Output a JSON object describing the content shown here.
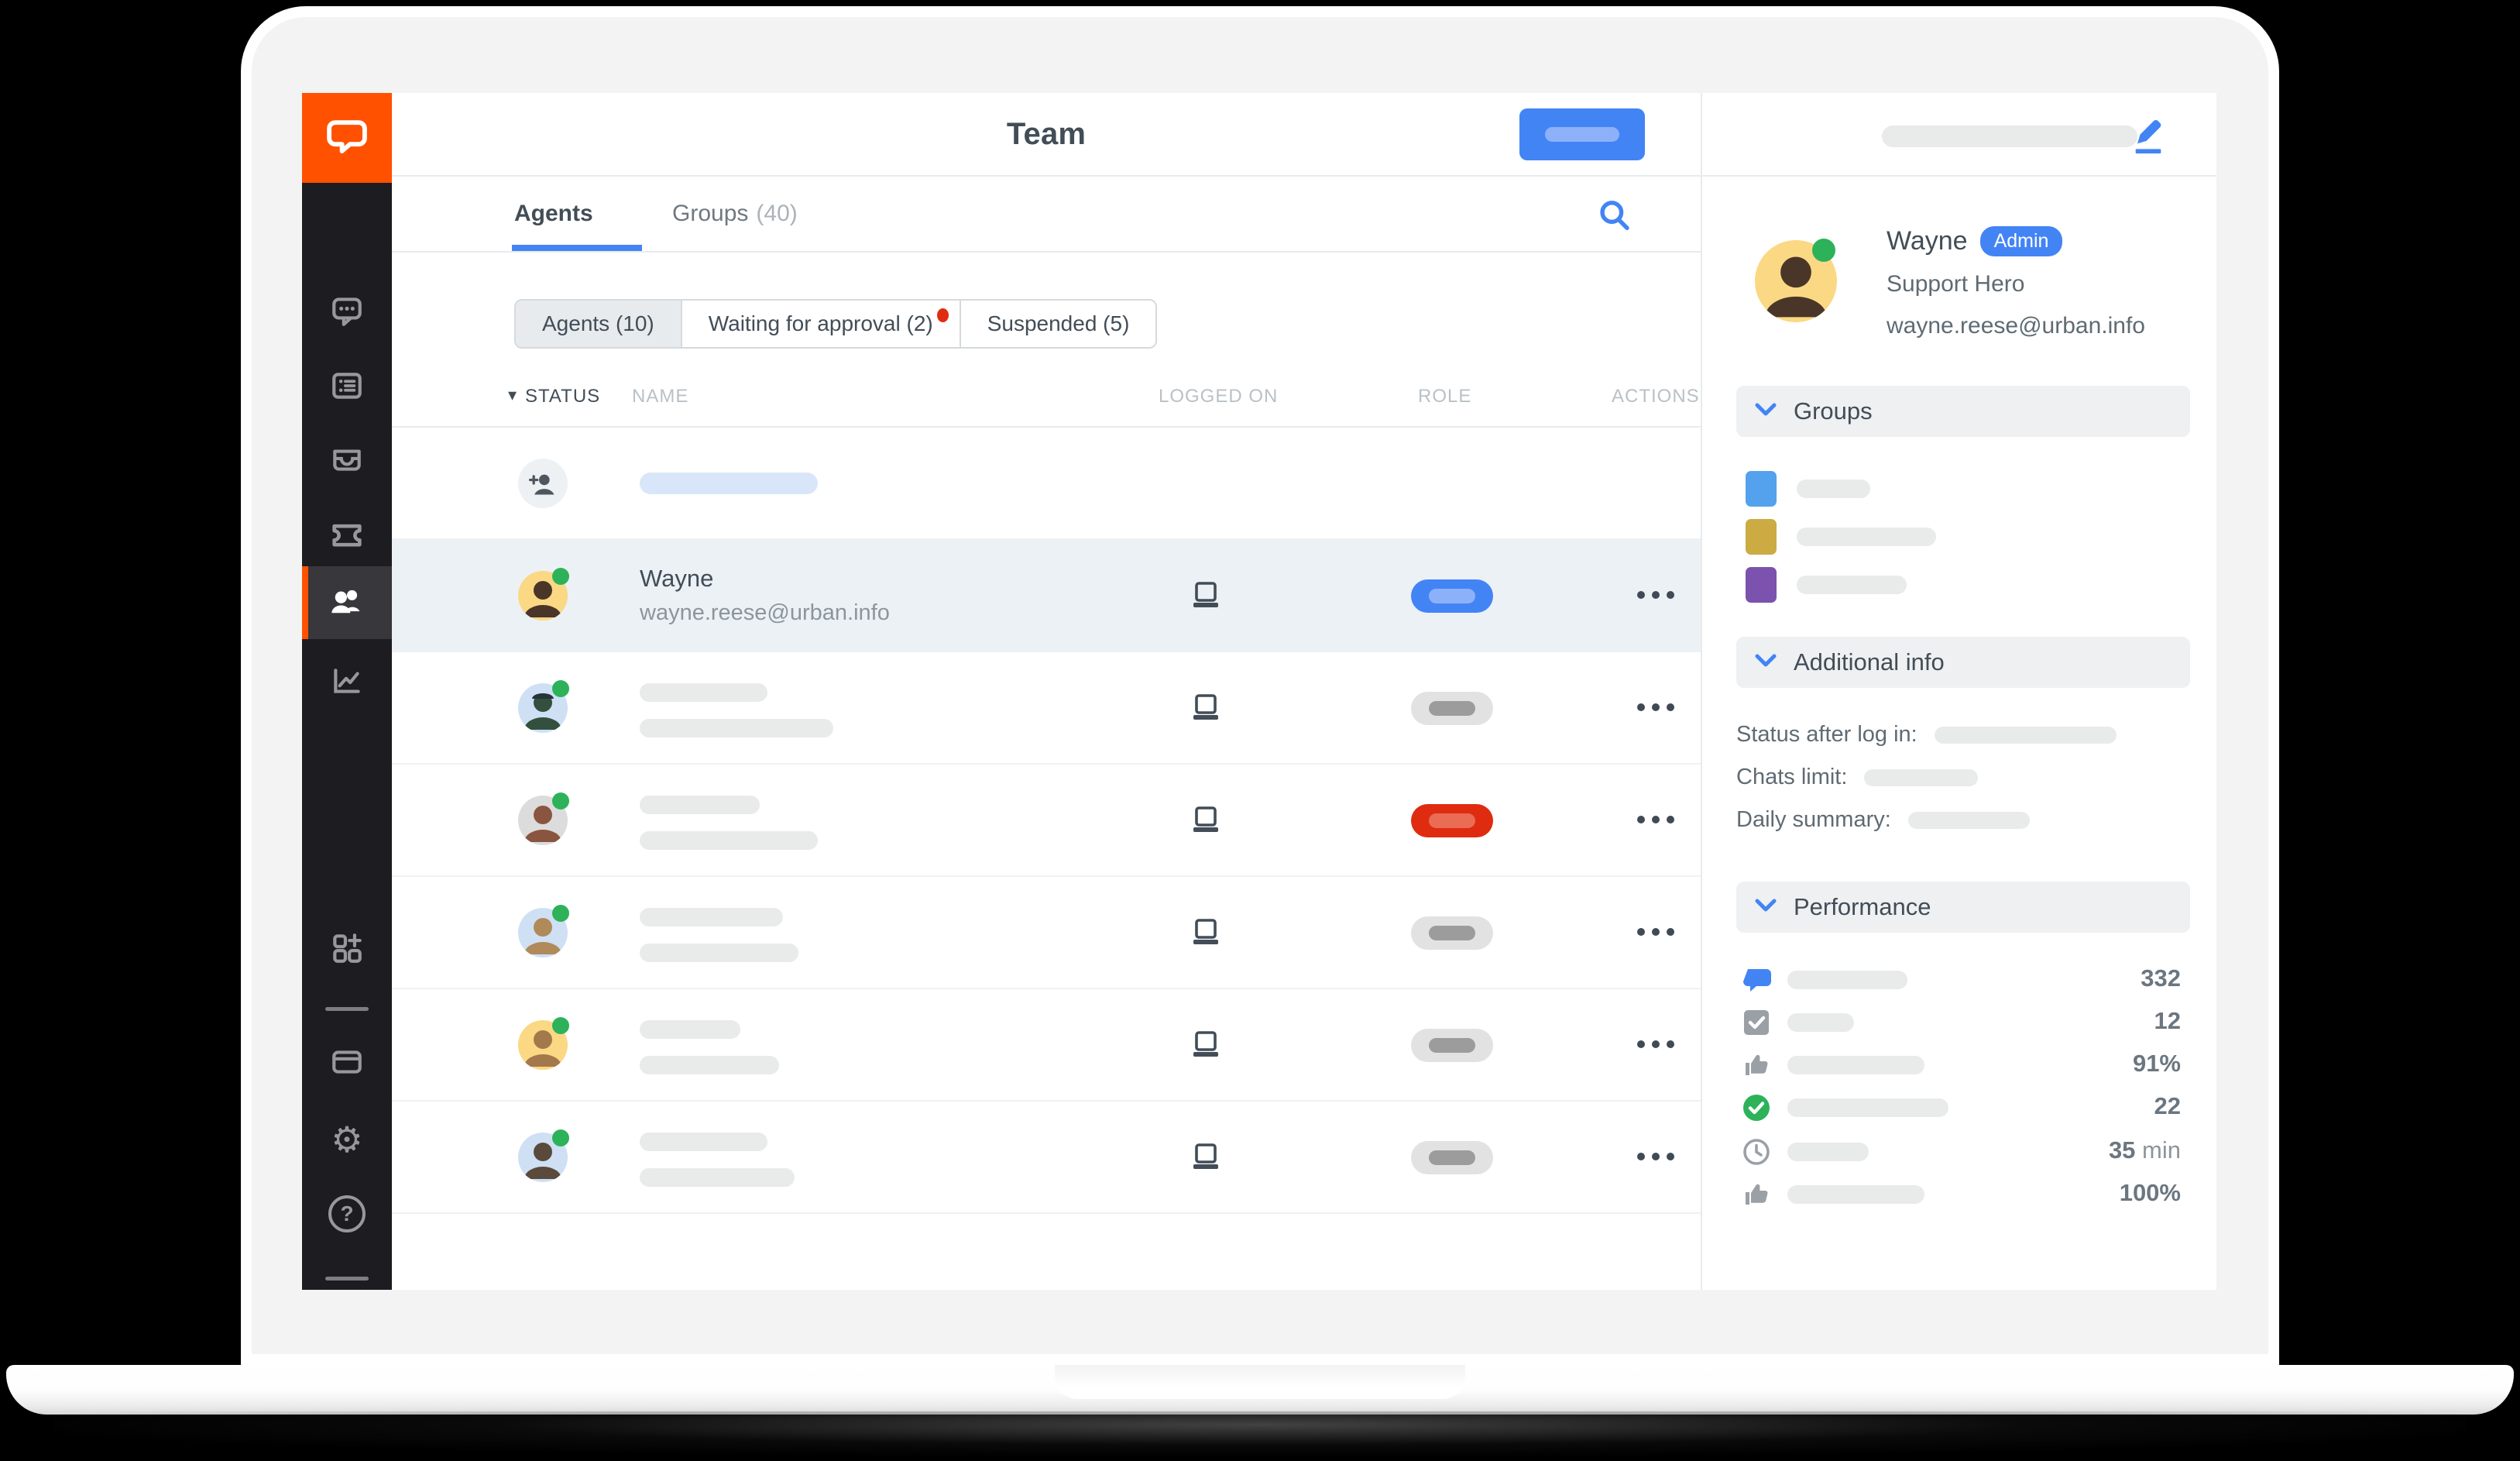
{
  "brand": {
    "accent_orange": "#ff5100",
    "accent_blue": "#4384f5",
    "online_green": "#2db25a",
    "alert_red": "#e02d12"
  },
  "header": {
    "title": "Team",
    "primary_button_label": ""
  },
  "tabs": {
    "agents": {
      "label": "Agents",
      "active": true
    },
    "groups": {
      "label": "Groups",
      "count": "(40)",
      "active": false
    }
  },
  "filters": {
    "agents": {
      "label": "Agents (10)",
      "active": true
    },
    "waiting": {
      "label": "Waiting for approval (2)",
      "has_notification": true
    },
    "suspended": {
      "label": "Suspended (5)"
    }
  },
  "table": {
    "headers": {
      "status": "STATUS",
      "name": "NAME",
      "logged_on": "LOGGED ON",
      "role": "ROLE",
      "actions": "ACTIONS"
    },
    "sort_column": "STATUS"
  },
  "agents": {
    "rows": [
      {
        "name": "Wayne",
        "email": "wayne.reese@urban.info",
        "online": true,
        "logged_on": "laptop",
        "role_pill": "blue",
        "selected": true
      },
      {
        "online": true,
        "logged_on": "laptop",
        "role_pill": "gray"
      },
      {
        "online": true,
        "logged_on": "laptop",
        "role_pill": "red"
      },
      {
        "online": true,
        "logged_on": "laptop",
        "role_pill": "gray"
      },
      {
        "online": true,
        "logged_on": "laptop",
        "role_pill": "gray"
      },
      {
        "online": true,
        "logged_on": "laptop",
        "role_pill": "gray"
      }
    ],
    "avatar_colors": [
      "#fbd883",
      "#cfe0f4",
      "#dcdcdc",
      "#cfe0f4",
      "#fbd883",
      "#cfe0f4"
    ]
  },
  "profile": {
    "name": "Wayne",
    "badge": "Admin",
    "role_title": "Support Hero",
    "email": "wayne.reese@urban.info"
  },
  "groups_section": {
    "title": "Groups",
    "items": [
      {
        "color": "#54a1ed"
      },
      {
        "color": "#ccab43"
      },
      {
        "color": "#7b52ad"
      }
    ]
  },
  "additional_info": {
    "title": "Additional info",
    "fields": [
      {
        "label": "Status after log in:"
      },
      {
        "label": "Chats limit:"
      },
      {
        "label": "Daily summary:"
      }
    ]
  },
  "performance": {
    "title": "Performance",
    "metrics": [
      {
        "icon": "chats-icon",
        "value": "332"
      },
      {
        "icon": "solved-checkbox-icon",
        "value": "12"
      },
      {
        "icon": "thumb-up-icon",
        "value": "91%"
      },
      {
        "icon": "resolved-check-icon",
        "value": "22"
      },
      {
        "icon": "clock-icon",
        "value": "35",
        "unit": "min"
      },
      {
        "icon": "thumb-up-icon",
        "value": "100%"
      }
    ]
  },
  "icons": {
    "gear_glyph": "⚙",
    "help_glyph": "?",
    "sort_desc_glyph": "▾"
  }
}
